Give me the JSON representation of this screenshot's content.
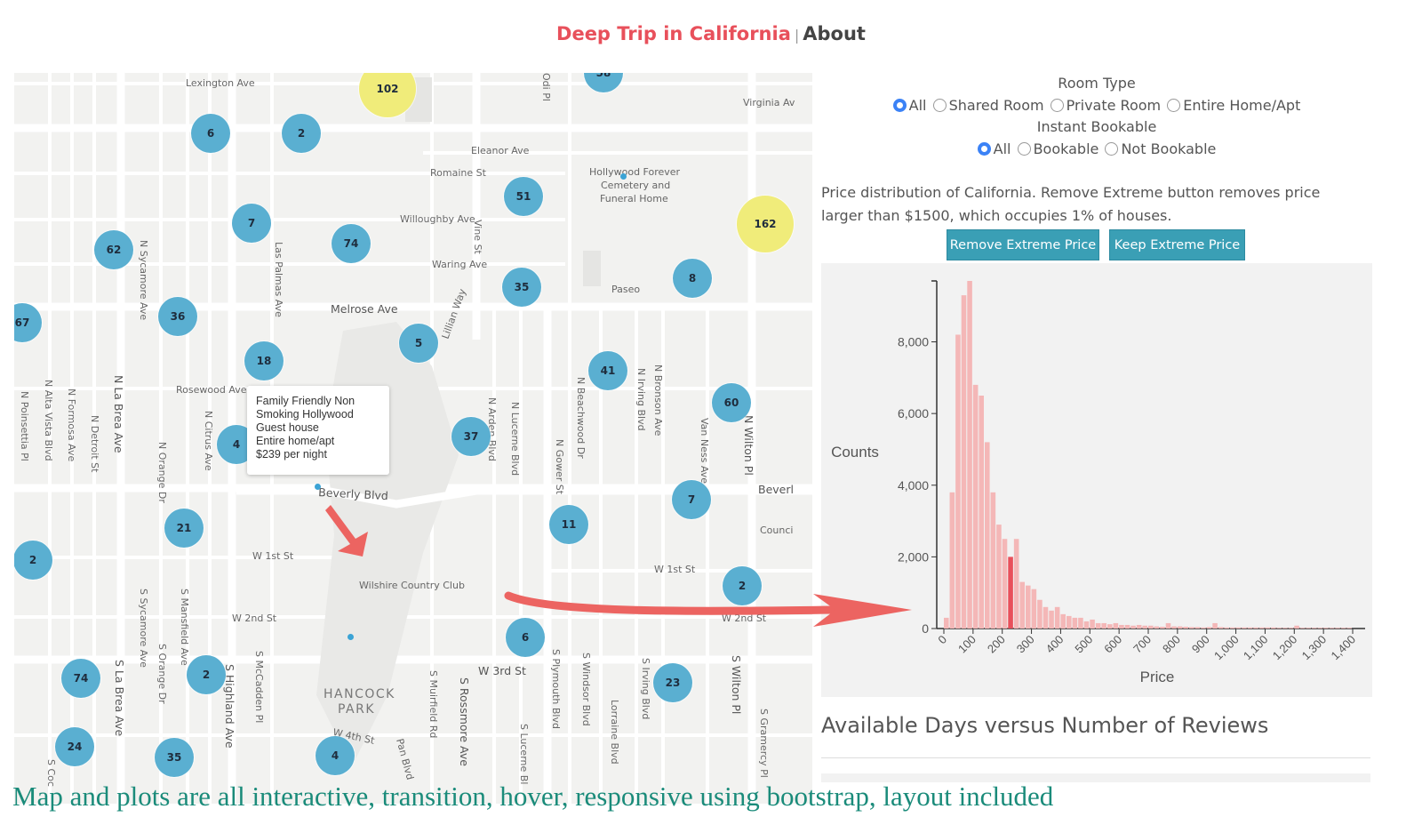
{
  "header": {
    "brand": "Deep Trip in California",
    "separator": "|",
    "about": "About"
  },
  "map": {
    "streets": [
      {
        "text": "Lexington Ave"
      },
      {
        "text": "Eleanor Ave"
      },
      {
        "text": "Romaine St"
      },
      {
        "text": "Willoughby Ave"
      },
      {
        "text": "Waring Ave"
      },
      {
        "text": "Melrose Ave"
      },
      {
        "text": "Rosewood Ave"
      },
      {
        "text": "Beverly Blvd"
      },
      {
        "text": "W 1st St"
      },
      {
        "text": "W 1st St"
      },
      {
        "text": "W 2nd St"
      },
      {
        "text": "W 2nd St"
      },
      {
        "text": "W 3rd St"
      },
      {
        "text": "W 4th St"
      },
      {
        "text": "Wilshire Country Club"
      },
      {
        "text": "Paseo"
      },
      {
        "text": "Virginia Av"
      },
      {
        "text": "Hollywood Forever"
      },
      {
        "text": "Cemetery and"
      },
      {
        "text": "Funeral Home"
      },
      {
        "text": "Beverl"
      },
      {
        "text": "Counci"
      }
    ],
    "vertical_streets": [
      {
        "text": "N Poinsettia Pl"
      },
      {
        "text": "N Alta Vista Blvd"
      },
      {
        "text": "N Formosa Ave"
      },
      {
        "text": "N Detroit St"
      },
      {
        "text": "N La Brea Ave"
      },
      {
        "text": "N Sycamore Ave"
      },
      {
        "text": "N Orange Dr"
      },
      {
        "text": "N Citrus Ave"
      },
      {
        "text": "Las Palmas Ave"
      },
      {
        "text": "Lillian Way"
      },
      {
        "text": "Vine St"
      },
      {
        "text": "N Arden Blvd"
      },
      {
        "text": "N Lucerne Blvd"
      },
      {
        "text": "N Gower St"
      },
      {
        "text": "N Beachwood Dr"
      },
      {
        "text": "N Irving Blvd"
      },
      {
        "text": "N Bronson Ave"
      },
      {
        "text": "Van Ness Ave"
      },
      {
        "text": "N Wilton Pl"
      },
      {
        "text": "S Sycamore Ave"
      },
      {
        "text": "S Mansfield Ave"
      },
      {
        "text": "S Orange Dr"
      },
      {
        "text": "S Highland Ave"
      },
      {
        "text": "S McCadden Pl"
      },
      {
        "text": "S La Brea Ave"
      },
      {
        "text": "S Muirfield Rd"
      },
      {
        "text": "S Rossmore Ave"
      },
      {
        "text": "S Plymouth Blvd"
      },
      {
        "text": "S Windsor Blvd"
      },
      {
        "text": "Lorraine Blvd"
      },
      {
        "text": "S Irving Blvd"
      },
      {
        "text": "S Wilton Pl"
      },
      {
        "text": "S Gramercy Pl"
      },
      {
        "text": "S Lucerne Bl"
      },
      {
        "text": "Odi Pl"
      },
      {
        "text": "Pan Blvd"
      },
      {
        "text": "S Coc"
      }
    ],
    "park_label": [
      "HANCOCK",
      "PARK"
    ],
    "clusters": [
      "6",
      "2",
      "102",
      "58",
      "51",
      "7",
      "74",
      "62",
      "162",
      "35",
      "8",
      "67",
      "36",
      "5",
      "18",
      "41",
      "60",
      "4",
      "37",
      "7",
      "21",
      "11",
      "2",
      "2",
      "6",
      "23",
      "74",
      "2",
      "24",
      "35",
      "4"
    ],
    "popup": [
      "Family Friendly Non",
      "Smoking Hollywood",
      "Guest house",
      "Entire home/apt",
      "$239 per night"
    ]
  },
  "filters": {
    "room_type_title": "Room Type",
    "room_types": [
      {
        "label": "All",
        "checked": true
      },
      {
        "label": "Shared Room",
        "checked": false
      },
      {
        "label": "Private Room",
        "checked": false
      },
      {
        "label": "Entire Home/Apt",
        "checked": false
      }
    ],
    "instant_title": "Instant Bookable",
    "instant": [
      {
        "label": "All",
        "checked": true
      },
      {
        "label": "Bookable",
        "checked": false
      },
      {
        "label": "Not Bookable",
        "checked": false
      }
    ]
  },
  "description": "Price distribution of California. Remove Extreme button removes price larger than $1500, which occupies 1% of houses.",
  "buttons": {
    "remove": "Remove Extreme Price",
    "keep": "Keep Extreme Price"
  },
  "chart_data": {
    "type": "bar",
    "xlabel": "Price",
    "ylabel": "Counts",
    "xlim": [
      0,
      1400
    ],
    "ylim": [
      0,
      9700
    ],
    "xticks": [
      "0",
      "100",
      "200",
      "300",
      "400",
      "500",
      "600",
      "700",
      "800",
      "900",
      "1,000",
      "1,100",
      "1,200",
      "1,300",
      "1,400"
    ],
    "yticks": [
      "0",
      "2,000",
      "4,000",
      "6,000",
      "8,000"
    ],
    "bin_width": 20,
    "highlight_bin": 11,
    "values": [
      300,
      3800,
      8200,
      9300,
      9700,
      6800,
      6500,
      5200,
      3800,
      2900,
      2500,
      2000,
      2500,
      1300,
      1200,
      1100,
      800,
      600,
      500,
      600,
      400,
      350,
      300,
      300,
      200,
      250,
      150,
      150,
      120,
      150,
      100,
      100,
      80,
      100,
      80,
      80,
      60,
      50,
      150,
      60,
      60,
      50,
      40,
      40,
      30,
      40,
      150,
      40,
      30,
      30,
      30,
      30,
      30,
      30,
      30,
      30,
      30,
      20,
      20,
      20,
      80,
      20,
      20,
      20,
      20,
      20,
      20,
      20,
      20,
      20
    ]
  },
  "section_title": "Available Days versus Number of Reviews",
  "caption": "Map and plots are all interactive, transition, hover, responsive using bootstrap, layout included",
  "colors": {
    "brand": "#e8505b",
    "cluster_blue": "#5aafd1",
    "cluster_yellow": "#f0ec7a",
    "bar": "#f4b7b7",
    "bar_highlight": "#e8505b",
    "button": "#3a9fb5",
    "caption": "#1a8b7a"
  }
}
